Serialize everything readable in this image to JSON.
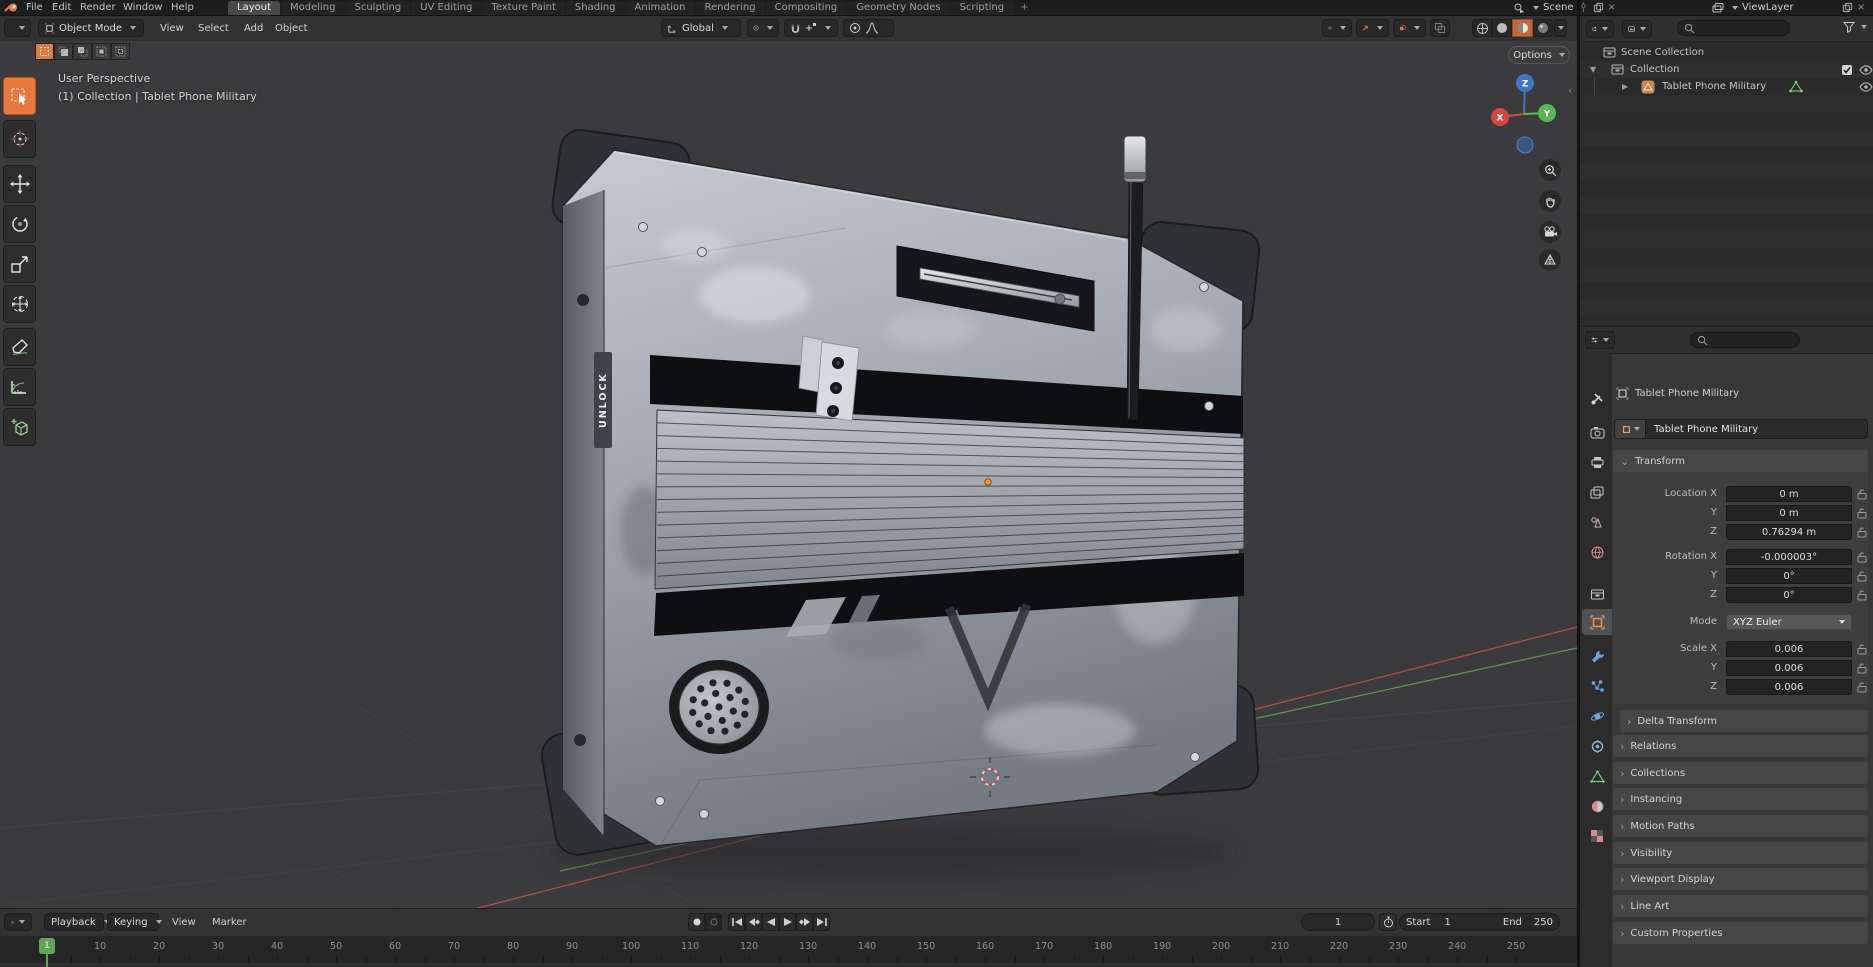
{
  "topbar": {
    "menus": [
      "File",
      "Edit",
      "Render",
      "Window",
      "Help"
    ],
    "workspaces": [
      "Layout",
      "Modeling",
      "Sculpting",
      "UV Editing",
      "Texture Paint",
      "Shading",
      "Animation",
      "Rendering",
      "Compositing",
      "Geometry Nodes",
      "Scripting"
    ],
    "active_workspace": "Layout",
    "new_workspace_label": "+",
    "scene_selector": {
      "value": "Scene"
    },
    "view_layer_selector": {
      "value": "ViewLayer"
    }
  },
  "viewport_header": {
    "mode": "Object Mode",
    "menus": [
      "View",
      "Select",
      "Add",
      "Object"
    ],
    "transform_orientation": "Global"
  },
  "viewport": {
    "options_button": "Options",
    "overlay": {
      "line1": "User Perspective",
      "line2": "(1) Collection | Tablet Phone Military"
    },
    "gizmo": {
      "x": "X",
      "y": "Y",
      "z": "Z"
    },
    "model_label": "UNLOCK",
    "toolbar_tools": [
      "select-box",
      "cursor",
      "move",
      "rotate",
      "scale",
      "transform",
      "annotate",
      "measure",
      "add-cube"
    ]
  },
  "outliner": {
    "rows": [
      {
        "label": "Scene Collection"
      },
      {
        "label": "Collection"
      },
      {
        "label": "Tablet Phone Military"
      }
    ]
  },
  "properties": {
    "breadcrumb": "Tablet Phone Military",
    "object_name": "Tablet Phone Military",
    "tabs": [
      "tool",
      "render",
      "output",
      "view-layer",
      "scene",
      "world",
      "collection",
      "object",
      "modifiers",
      "particles",
      "physics",
      "constraints",
      "object-data",
      "material",
      "texture"
    ],
    "active_tab": "object",
    "transform": {
      "title": "Transform",
      "rows": [
        {
          "label": "Location X",
          "value": "0 m"
        },
        {
          "label": "Y",
          "value": "0 m"
        },
        {
          "label": "Z",
          "value": "0.76294 m"
        },
        {
          "label": "Rotation X",
          "value": "-0.000003°"
        },
        {
          "label": "Y",
          "value": "0°"
        },
        {
          "label": "Z",
          "value": "0°"
        },
        {
          "label": "Mode",
          "value": "XYZ Euler"
        },
        {
          "label": "Scale X",
          "value": "0.006"
        },
        {
          "label": "Y",
          "value": "0.006"
        },
        {
          "label": "Z",
          "value": "0.006"
        }
      ]
    },
    "panels": [
      "Delta Transform",
      "Relations",
      "Collections",
      "Instancing",
      "Motion Paths",
      "Visibility",
      "Viewport Display",
      "Line Art",
      "Custom Properties"
    ]
  },
  "timeline": {
    "menus": [
      "Playback",
      "Keying",
      "View",
      "Marker"
    ],
    "current_frame": "1",
    "start": {
      "label": "Start",
      "value": "1"
    },
    "end": {
      "label": "End",
      "value": "250"
    },
    "ruler": {
      "labels": [
        10,
        20,
        30,
        40,
        50,
        60,
        70,
        80,
        90,
        100,
        110,
        120,
        130,
        140,
        150,
        160,
        170,
        180,
        190,
        200,
        210,
        220,
        230,
        240,
        250
      ],
      "current": "1"
    }
  },
  "colors": {
    "accent_orange": "#e8793e",
    "frame_marker_green": "#5fa558",
    "axis_red": "#b85252",
    "axis_green": "#5d9e5d",
    "gizmo_x_red": "#d04840",
    "gizmo_y_green": "#58b852",
    "gizmo_z_blue": "#3f74c9"
  }
}
